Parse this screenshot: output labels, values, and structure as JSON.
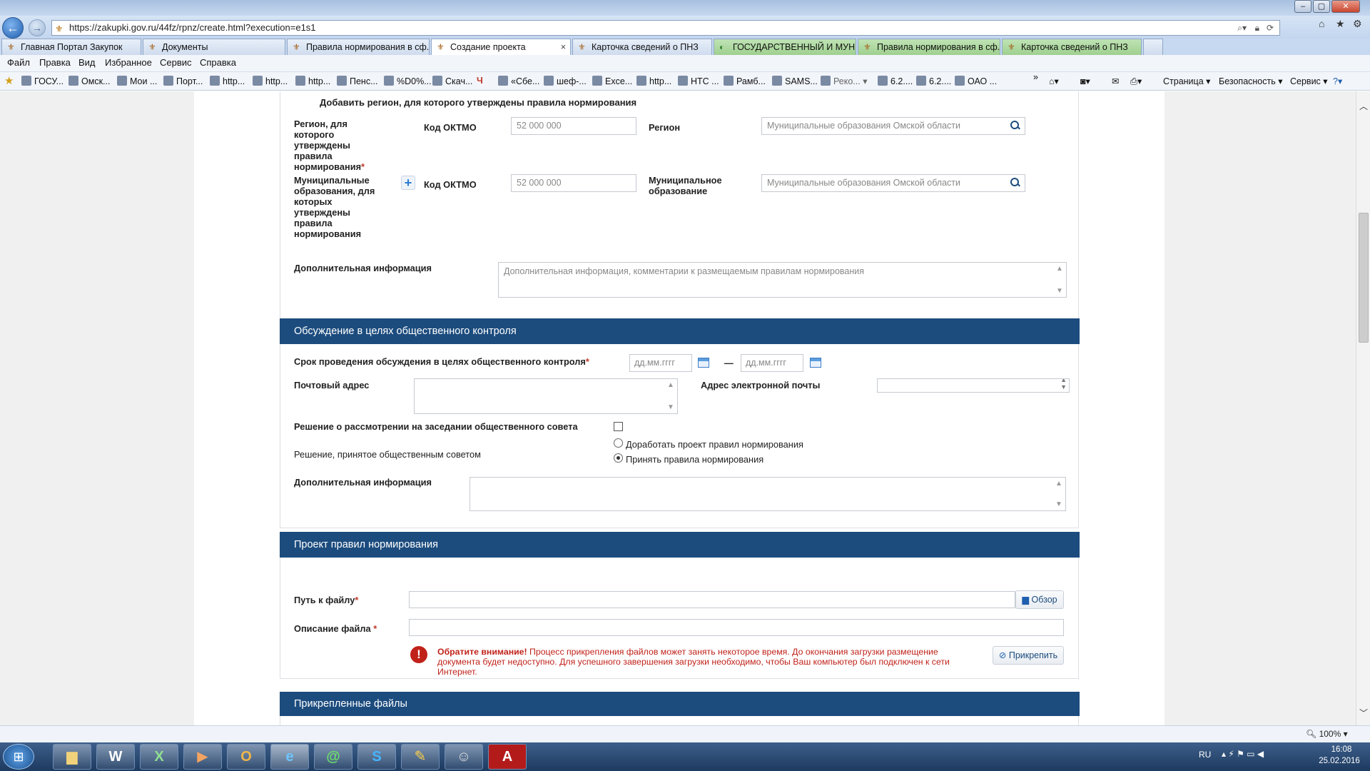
{
  "browser": {
    "url": "https://zakupki.gov.ru/44fz/rpnz/create.html?execution=e1s1",
    "tabs": [
      {
        "label": "Главная Портал Закупок"
      },
      {
        "label": "Документы"
      },
      {
        "label": "Правила нормирования в сф..."
      },
      {
        "label": "Создание проекта"
      },
      {
        "label": "Карточка сведений о ПНЗ"
      },
      {
        "label": "ГОСУДАРСТВЕННЫЙ И МУН..."
      },
      {
        "label": "Правила нормирования в сф..."
      },
      {
        "label": "Карточка сведений о ПНЗ"
      }
    ],
    "menu": [
      "Файл",
      "Правка",
      "Вид",
      "Избранное",
      "Сервис",
      "Справка"
    ],
    "favorites": [
      "ГОСУ...",
      "Омск...",
      "Мои ...",
      "Порт...",
      "http...",
      "http...",
      "http...",
      "Пенс...",
      "%D0%...",
      "Скач...",
      "«Сбе...",
      "шеф-...",
      "Exce...",
      "http...",
      "НТС ...",
      "Рамб...",
      "SAMS...",
      "Реко...",
      "6.2....",
      "6.2....",
      "ОАО ..."
    ],
    "command_bar": {
      "page": "Страница",
      "safety": "Безопасность",
      "tools": "Сервис"
    },
    "zoom": "100%"
  },
  "form": {
    "region_section": {
      "add_region_link": "Добавить регион, для которого утверждены правила нормирования",
      "region_label": "Регион, для которого утверждены правила нормирования",
      "oktmo_label": "Код ОКТМО",
      "oktmo_placeholder": "52 000 000",
      "region_field_label": "Регион",
      "region_placeholder": "Муниципальные образования Омской области",
      "municipal_label": "Муниципальные образования, для которых утверждены правила нормирования",
      "municipal_oktmo_label": "Код ОКТМО",
      "municipal_oktmo_placeholder": "52 000 000",
      "municipal_field_label": "Муниципальное образование",
      "municipal_placeholder": "Муниципальные образования Омской области",
      "additional_label": "Дополнительная информация",
      "additional_placeholder": "Дополнительная информация, комментарии к размещаемым правилам нормирования"
    },
    "discussion_section": {
      "header": "Обсуждение в целях общественного контроля",
      "period_label": "Срок проведения обсуждения в целях общественного контроля",
      "date_from_placeholder": "дд.мм.гггг",
      "date_separator": "—",
      "date_to_placeholder": "дд.мм.гггг",
      "postal_label": "Почтовый адрес",
      "email_label": "Адрес электронной почты",
      "council_review_label": "Решение о рассмотрении на заседании общественного совета",
      "council_decision_label": "Решение, принятое общественным советом",
      "decision_options": [
        "Доработать проект правил нормирования",
        "Принять правила нормирования"
      ],
      "decision_selected": "Принять правила нормирования",
      "additional_label": "Дополнительная информация"
    },
    "project_section": {
      "header": "Проект правил нормирования",
      "file_path_label": "Путь к файлу",
      "browse_button": "Обзор",
      "file_desc_label": "Описание файла ",
      "warning_title": "Обратите внимание!",
      "warning_text": " Процесс прикрепления файлов может занять некоторое время. До окончания загрузки размещение документа будет недоступно. Для успешного завершения загрузки необходимо, чтобы Ваш компьютер был подключен к сети Интернет.",
      "attach_button": "Прикрепить"
    },
    "attached_section": {
      "header": "Прикрепленные файлы"
    }
  },
  "taskbar": {
    "apps": [
      "W",
      "X",
      "▶",
      "O",
      "e",
      "@",
      "S",
      "✎",
      "☺",
      "A"
    ],
    "lang": "RU",
    "time": "16:08",
    "date": "25.02.2016"
  },
  "colors": {
    "section_header": "#1c4c7e",
    "required": "#c0392b",
    "warning": "#c0221a"
  }
}
